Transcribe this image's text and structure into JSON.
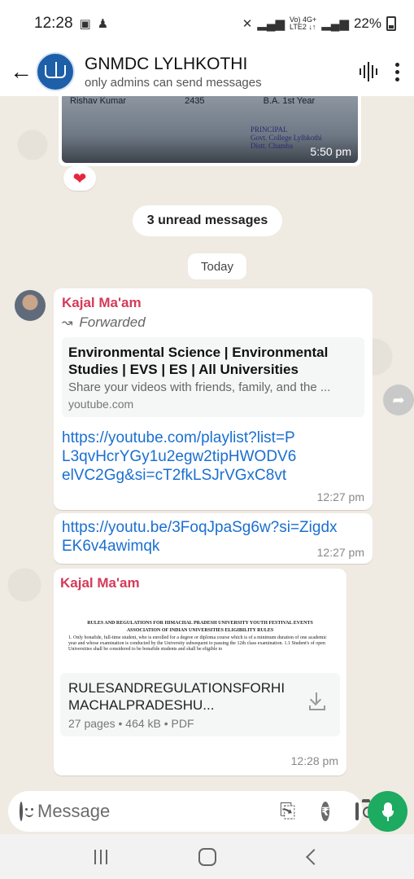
{
  "statusbar": {
    "time": "12:28",
    "network_text": "Vo) 4G+",
    "network_sub": "LTE2 ↓↑",
    "battery": "22%"
  },
  "header": {
    "title": "GNMDC LYLHKOTHI",
    "subtitle": "only admins can send messages"
  },
  "chat": {
    "image_message": {
      "row_name": "Rishav Kumar",
      "row_number": "2435",
      "row_class": "B.A. 1st Year",
      "stamp_line1": "PRINCIPAL",
      "stamp_line2": "Govt. College Lylhkothi",
      "stamp_line3": "Distt. Chamba",
      "time": "5:50 pm",
      "reaction": "❤"
    },
    "unread_label": "3 unread messages",
    "date_label": "Today",
    "message1": {
      "sender": "Kajal Ma'am",
      "forwarded_label": "Forwarded",
      "preview_title": "Environmental Science | Environmental Studies | EVS | ES | All Universities",
      "preview_desc": "Share your videos with friends, family, and the ...",
      "preview_domain": "youtube.com",
      "link": "https://youtube.com/playlist?list=PL3qvHcrYGy1u2egw2tipHWODV6elVC2Gg&si=cT2fkLSJrVGxC8vt",
      "time": "12:27 pm"
    },
    "message2": {
      "link": "https://youtu.be/3FoqJpaSg6w?si=ZigdxEK6v4awimqk",
      "time": "12:27 pm"
    },
    "message3": {
      "sender": "Kajal Ma'am",
      "doc_heading1": "RULES AND REGULATIONS FOR HIMACHAL PRADESH UNIVERSITY YOUTH FESTIVAL EVENTS",
      "doc_heading2": "ASSOCIATION OF INDIAN UNIVERSITIES ELIGIBILITY RULES",
      "doc_body": "1. Only bonafide, full-time student, who is enrolled for a degree or diploma course which is of a minimum duration of one academic year and whose examination is conducted by the University subsequent to passing the 12th class examination. 1.1 Student's of open Universities shall be considered to be bonafide students and shall be eligible to",
      "doc_name": "RULESANDREGULATIONSFORHIMACHALPRADESHU...",
      "doc_meta": "27 pages • 464 kB • PDF",
      "time": "12:28 pm"
    }
  },
  "input": {
    "placeholder": "Message"
  },
  "colors": {
    "accent_green": "#1daa61",
    "sender_name": "#d43a57",
    "link": "#1a6fd0",
    "chat_bg": "#efeae2"
  }
}
